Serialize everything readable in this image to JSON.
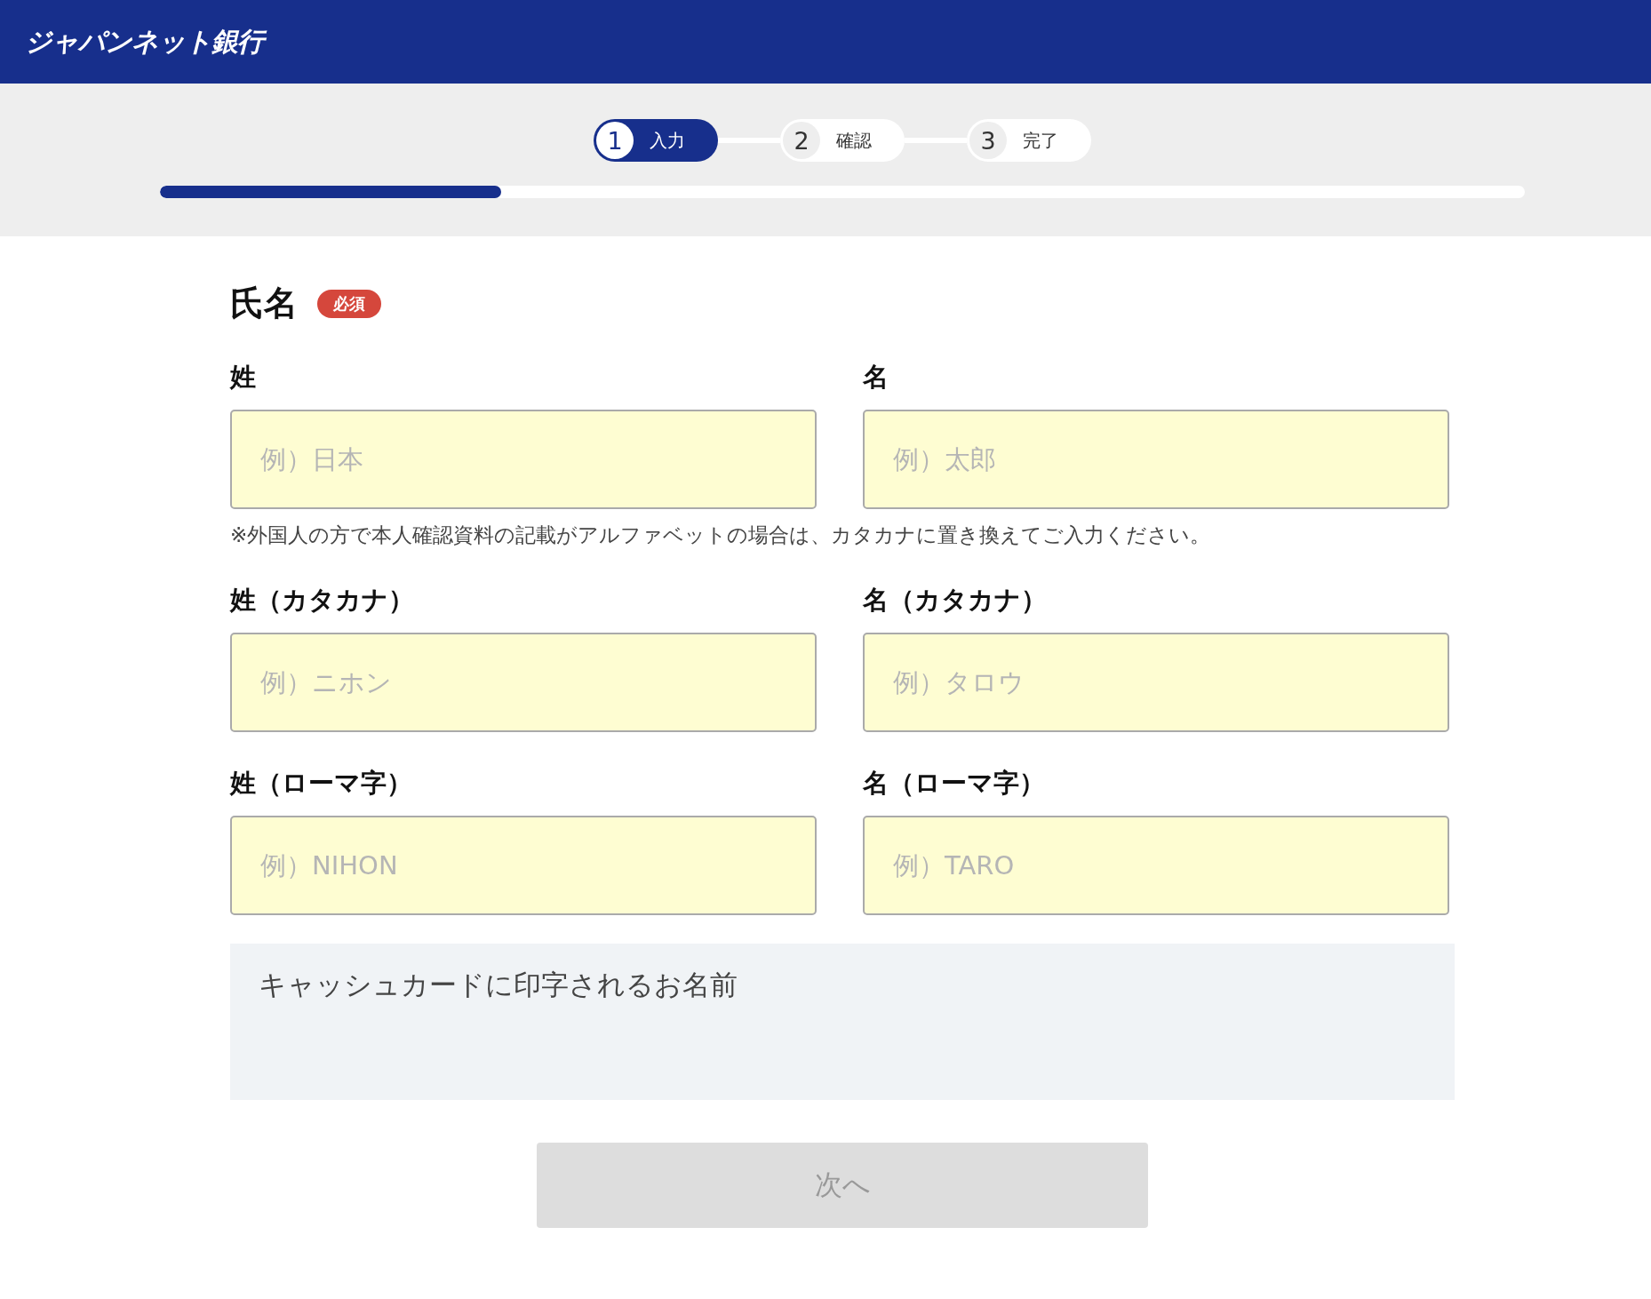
{
  "header": {
    "logo": "ジャパンネット銀行"
  },
  "steps": [
    {
      "number": "1",
      "label": "入力",
      "selected": true
    },
    {
      "number": "2",
      "label": "確認",
      "selected": false
    },
    {
      "number": "3",
      "label": "完了",
      "selected": false
    }
  ],
  "progress": {
    "level": 0.25
  },
  "section": {
    "title": "氏名",
    "badge": "必須"
  },
  "rows": [
    {
      "fields": [
        {
          "label": "姓",
          "placeholder": "例）日本"
        },
        {
          "label": "名",
          "placeholder": "例）太郎"
        }
      ],
      "note": "※外国人の方で本人確認資料の記載がアルファベットの場合は、カタカナに置き換えてご入力ください。"
    },
    {
      "fields": [
        {
          "label": "姓（カタカナ）",
          "placeholder": "例）ニホン"
        },
        {
          "label": "名（カタカナ）",
          "placeholder": "例）タロウ"
        }
      ]
    },
    {
      "fields": [
        {
          "label": "姓（ローマ字）",
          "placeholder": "例）NIHON"
        },
        {
          "label": "名（ローマ字）",
          "placeholder": "例）TARO"
        }
      ]
    }
  ],
  "card_name": {
    "label": "キャッシュカードに印字されるお名前"
  },
  "next_button": {
    "label": "次へ",
    "disabled": true
  }
}
